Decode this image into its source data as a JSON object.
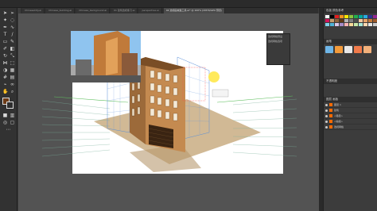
{
  "app": {
    "logo_text": "Ai"
  },
  "tabs": [
    {
      "label": "ChineseCity.ai",
      "active": false
    },
    {
      "label": "Chinese_building.ai",
      "active": false
    },
    {
      "label": "Chinese_background.ai",
      "active": false
    },
    {
      "label": "01 建筑透视练习.ai",
      "active": false
    },
    {
      "label": "perspective.ai",
      "active": false
    },
    {
      "label": "04 透视画城堡工具.ai* @ 100% (CMYK/GPU 预览)",
      "active": true
    }
  ],
  "perspective_panel": {
    "title": "透视网格预设",
    "sub": "透视网格选项"
  },
  "right_dock": {
    "swatches_title": "色板  颜色参考",
    "brushes_title": "画笔",
    "properties_title": "不透明度",
    "layers_title": "图层  画板",
    "layers": [
      {
        "name": "图层 1",
        "color": "#ff6a00"
      },
      {
        "name": "建筑",
        "color": "#ff6a00"
      },
      {
        "name": "<路径>",
        "color": "#ff6a00"
      },
      {
        "name": "<编组>",
        "color": "#ff6a00"
      },
      {
        "name": "透视网格",
        "color": "#ff6a00"
      }
    ]
  },
  "colors": {
    "fill_swatch": "#6b3a16",
    "building_brown": "#b8804a",
    "building_shadow": "#8a5a2e",
    "accent_yellow": "#ffe84a"
  }
}
